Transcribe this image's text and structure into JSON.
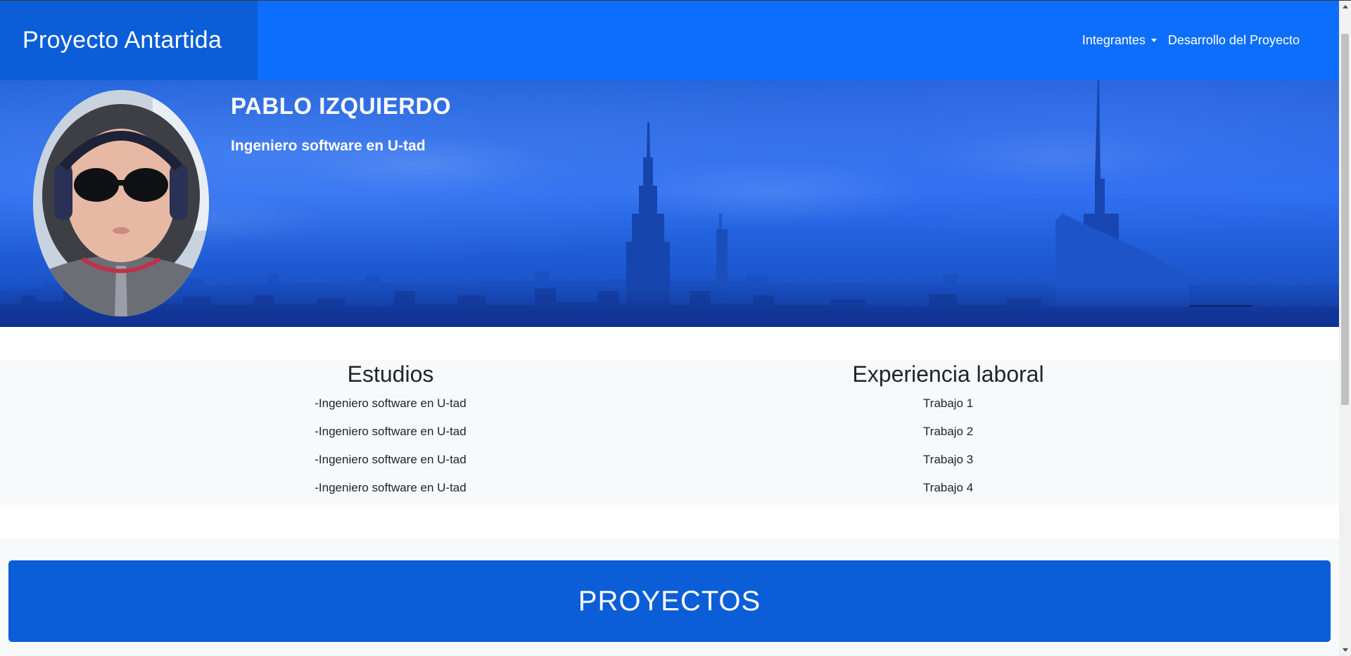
{
  "navbar": {
    "brand": "Proyecto Antartida",
    "links": [
      {
        "label": "Integrantes",
        "icon": "caret-down-icon"
      },
      {
        "label": "Desarrollo del Proyecto"
      }
    ]
  },
  "hero": {
    "name": "PABLO IZQUIERDO",
    "subtitle": "Ingeniero software en U-tad"
  },
  "studies": {
    "heading": "Estudios",
    "items": [
      "-Ingeniero software en U-tad",
      "-Ingeniero software en U-tad",
      "-Ingeniero software en U-tad",
      "-Ingeniero software en U-tad"
    ]
  },
  "experience": {
    "heading": "Experiencia laboral",
    "items": [
      "Trabajo 1",
      "Trabajo 2",
      "Trabajo 3",
      "Trabajo 4"
    ]
  },
  "projects": {
    "heading": "PROYECTOS"
  },
  "colors": {
    "primary": "#0d6efd",
    "primary_dark": "#0b5ed7",
    "light_bg": "#f8f9fa",
    "text": "#212529"
  }
}
